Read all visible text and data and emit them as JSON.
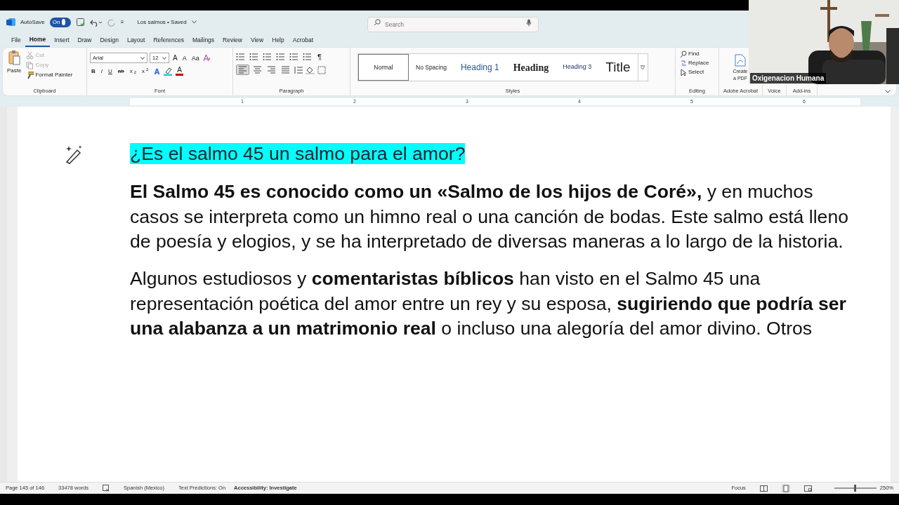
{
  "title_bar": {
    "autosave_label": "AutoSave",
    "autosave_toggle": {
      "label": "On",
      "on": true
    },
    "quick_menu": "≡",
    "document_title": "Los salmos • Saved",
    "search": {
      "placeholder": "Search"
    }
  },
  "tabs": [
    {
      "label": "File",
      "selected": false
    },
    {
      "label": "Home",
      "selected": true
    },
    {
      "label": "Insert",
      "selected": false
    },
    {
      "label": "Draw",
      "selected": false
    },
    {
      "label": "Design",
      "selected": false
    },
    {
      "label": "Layout",
      "selected": false
    },
    {
      "label": "References",
      "selected": false
    },
    {
      "label": "Mailings",
      "selected": false
    },
    {
      "label": "Review",
      "selected": false
    },
    {
      "label": "View",
      "selected": false
    },
    {
      "label": "Help",
      "selected": false
    },
    {
      "label": "Acrobat",
      "selected": false
    }
  ],
  "ribbon": {
    "clipboard": {
      "paste": "Paste",
      "cut": {
        "label": "Cut",
        "disabled": true
      },
      "copy": {
        "label": "Copy",
        "disabled": true
      },
      "format_painter": "Format Painter",
      "group_label": "Clipboard"
    },
    "font": {
      "font_name": "Arial",
      "font_size": "12",
      "grow": "A",
      "shrink": "A",
      "change_case": "Aa",
      "format_buttons": [
        "B",
        "I",
        "U",
        "ab",
        "x$_{2}$",
        "x$^{2}$"
      ],
      "text_effects": "A",
      "font_color": "A",
      "group_label": "Font"
    },
    "paragraph": {
      "pilcrow": "¶",
      "alignments": [
        {
          "kind": "left",
          "selected": true
        },
        {
          "kind": "center",
          "selected": false
        },
        {
          "kind": "right",
          "selected": false
        },
        {
          "kind": "justify",
          "selected": false
        }
      ],
      "group_label": "Paragraph"
    },
    "styles": {
      "items": [
        {
          "label": "Normal",
          "kind": "normal",
          "selected": true
        },
        {
          "label": "No Spacing",
          "kind": "normal",
          "selected": false
        },
        {
          "label": "Heading 1",
          "kind": "heading1",
          "selected": false
        },
        {
          "label": "Heading",
          "kind": "heading2",
          "selected": false
        },
        {
          "label": "Heading 3",
          "kind": "heading3",
          "selected": false
        },
        {
          "label": "Title",
          "kind": "title",
          "selected": false
        }
      ],
      "group_label": "Styles"
    },
    "editing": {
      "find": "Find",
      "replace": "Replace",
      "select": "Select",
      "group_label": "Editing"
    },
    "acrobat": {
      "create_pdf": "Create a PDF",
      "group_label": "Adobe Acrobat"
    },
    "voice": {
      "group_label": "Voice"
    },
    "addins": {
      "group_label": "Add-ins"
    }
  },
  "ruler": {
    "numbers": [
      "1",
      "2",
      "3",
      "4",
      "5",
      "6"
    ]
  },
  "document": {
    "heading": {
      "text": "¿Es el salmo 45 un salmo para el amor?",
      "highlighted": true
    },
    "paragraphs": [
      "**El Salmo 45 es conocido como un «Salmo de los hijos de Coré»,** y en muchos casos se interpreta como un himno real o una canción de bodas. Este salmo está lleno de poesía y elogios, y se ha interpretado de diversas maneras a lo largo de la historia.",
      "Algunos estudiosos y **comentaristas bíblicos** han visto en el Salmo 45 una representación poética del amor entre un rey y su esposa, **sugiriendo que podría ser una alabanza a un matrimonio real** o incluso una alegoría del amor divino. Otros"
    ]
  },
  "status_bar": {
    "page": "Page 145 of 146",
    "words": "33478 words",
    "language": "Spanish (Mexico)",
    "text_predictions": "Text Predictions: On",
    "accessibility": "Accessibility: Investigate",
    "focus": "Focus",
    "zoom_slider": {
      "level": 0.5
    },
    "zoom": "250%"
  },
  "video_overlay": {
    "kind": "picture",
    "name_label": "Oxigenacion Humana"
  }
}
